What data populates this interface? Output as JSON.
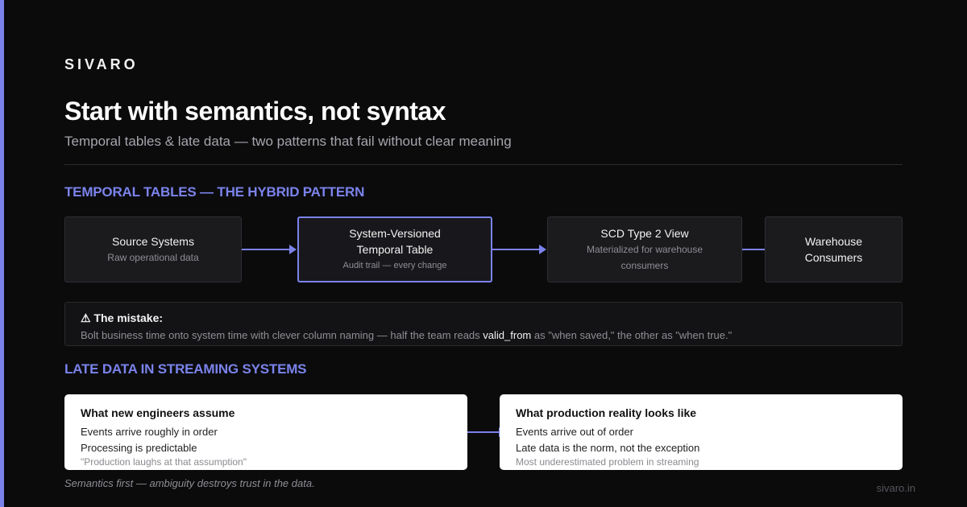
{
  "brand": "SIVARO",
  "title": "Start with semantics, not syntax",
  "subtitle": "Temporal tables & late data — two patterns that fail without clear meaning",
  "section1": {
    "heading": "TEMPORAL TABLES — THE HYBRID PATTERN",
    "flow": [
      {
        "title": "Source Systems",
        "desc": "Raw operational data"
      },
      {
        "title": "System-Versioned Temporal Table",
        "desc": "Audit trail — every change"
      },
      {
        "title": "SCD Type 2 View",
        "desc": "Materialized for warehouse consumers"
      },
      {
        "title": "Warehouse Consumers",
        "desc": ""
      }
    ]
  },
  "mistake": {
    "icon": "warning-icon",
    "title": "⚠ The mistake:",
    "text_before": "Bolt business time onto system time with clever column naming — half the team reads ",
    "code": "valid_from",
    "text_after": " as \"when saved,\" the other as \"when true.\""
  },
  "section2": {
    "heading": "LATE DATA IN STREAMING SYSTEMS",
    "assume": {
      "title": "What new engineers assume",
      "items": [
        "Events arrive roughly in order",
        "Processing is predictable"
      ],
      "note": "\"Production laughs at that assumption\""
    },
    "reality": {
      "title": "What production reality looks like",
      "items": [
        "Events arrive out of order",
        "Late data is the norm, not the exception"
      ],
      "note": "Most underestimated problem in streaming"
    }
  },
  "footer": {
    "note": "Semantics first — ambiguity destroys trust in the data.",
    "url": "sivaro.in"
  },
  "colors": {
    "background": "#0b0b0c",
    "accent": "#7b83eb",
    "card": "#ffffff"
  }
}
